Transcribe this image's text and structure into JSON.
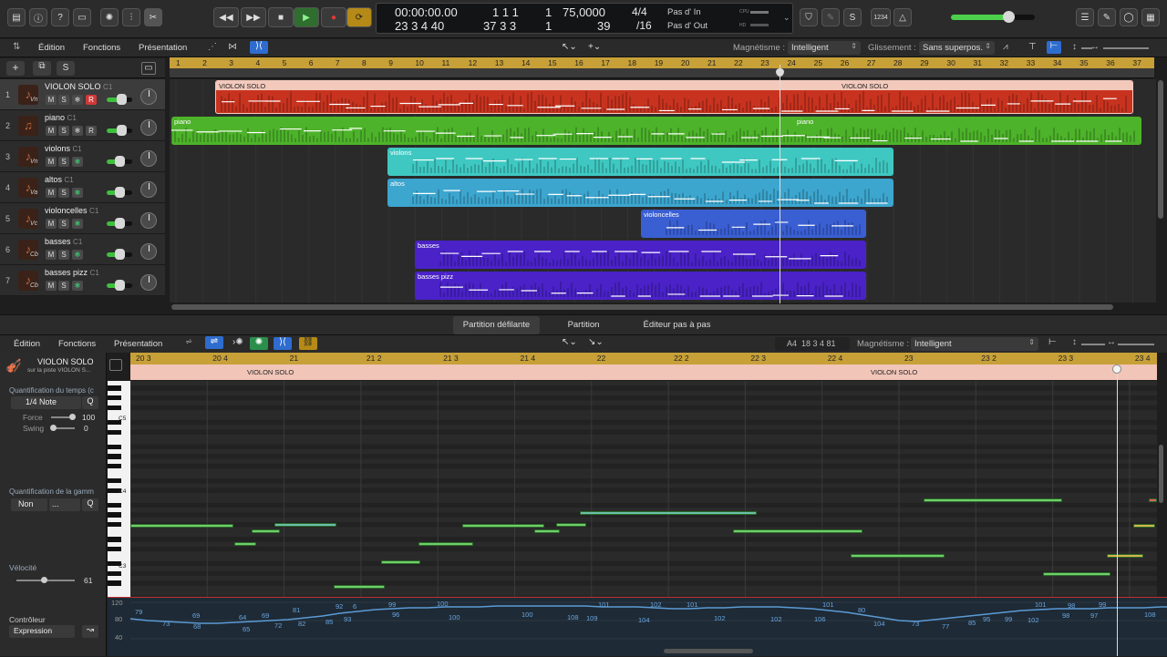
{
  "transport": {
    "time": "00:00:00.00",
    "time_small": "01",
    "smpte": "23 3 4 40",
    "bar": "1 1 1",
    "bar_beat": "1",
    "bar_pos": "37 3 3",
    "bar_pos_tick": "1",
    "tempo": "75,0000",
    "tempo_sub": "39",
    "signature": "4/4",
    "division": "/16",
    "in_label": "Pas d' In",
    "out_label": "Pas d' Out",
    "cpu_label": "CPU",
    "hd_label": "HD",
    "count_in": "1234"
  },
  "arrange_bar": {
    "menus": [
      "Édition",
      "Fonctions",
      "Présentation"
    ],
    "snap_label": "Magnétisme :",
    "snap_value": "Intelligent",
    "drag_label": "Glissement :",
    "drag_value": "Sans superpos."
  },
  "ruler_bars": [
    "1",
    "2",
    "3",
    "4",
    "5",
    "6",
    "7",
    "8",
    "9",
    "10",
    "11",
    "12",
    "13",
    "14",
    "15",
    "16",
    "17",
    "18",
    "19",
    "20",
    "21",
    "22",
    "23",
    "24",
    "25",
    "26",
    "27",
    "28",
    "29",
    "30",
    "31",
    "32",
    "33",
    "34",
    "35",
    "36",
    "37"
  ],
  "tracks": [
    {
      "num": "1",
      "name": "VIOLON SOLO",
      "ch": "C1",
      "inst": "Vn",
      "rec": true,
      "freeze": false
    },
    {
      "num": "2",
      "name": "piano",
      "ch": "C1",
      "inst": "",
      "rec": true,
      "freeze": false
    },
    {
      "num": "3",
      "name": "violons",
      "ch": "C1",
      "inst": "Vn",
      "rec": false,
      "freeze": true
    },
    {
      "num": "4",
      "name": "altos",
      "ch": "C1",
      "inst": "Va",
      "rec": false,
      "freeze": true
    },
    {
      "num": "5",
      "name": "violoncelles",
      "ch": "C1",
      "inst": "Vc",
      "rec": false,
      "freeze": true
    },
    {
      "num": "6",
      "name": "basses",
      "ch": "C1",
      "inst": "Cb",
      "rec": false,
      "freeze": true
    },
    {
      "num": "7",
      "name": "basses pizz",
      "ch": "C1",
      "inst": "Cb",
      "rec": false,
      "freeze": true
    }
  ],
  "region_labels": {
    "violon_solo_a": "VIOLON SOLO",
    "violon_solo_b": "VIOLON SOLO",
    "piano_a": "piano",
    "piano_b": "piano",
    "violons": "violons",
    "altos": "altos",
    "violoncelles": "violoncelles",
    "basses": "basses",
    "basses_pizz": "basses pizz"
  },
  "colors": {
    "red": "#c8331f",
    "green": "#4db32a",
    "teal": "#3fc8c2",
    "cyan": "#3ca6cf",
    "blue": "#3a5fd3",
    "purple": "#4a22c8"
  },
  "editor_tabs": [
    "Partition défilante",
    "Partition",
    "Éditeur pas à pas"
  ],
  "editor_bar": {
    "menus": [
      "Édition",
      "Fonctions",
      "Présentation"
    ],
    "position": "A4  18 3 4 81",
    "snap_label": "Magnétisme :",
    "snap_value": "Intelligent"
  },
  "inspector": {
    "region_name": "VIOLON SOLO",
    "region_sub": "sur la piste VIOLON S...",
    "quant_label": "Quantification du temps (c",
    "quant_value": "1/4 Note",
    "q": "Q",
    "force_label": "Force",
    "force_value": "100",
    "swing_label": "Swing",
    "swing_value": "0",
    "scale_label": "Quantification de la gamm",
    "scale_value": "Non",
    "scale_value2": "...",
    "velocity_label": "Vélocité",
    "velocity_value": "61",
    "controller_label": "Contrôleur",
    "controller_value": "Expression"
  },
  "editor_ruler": [
    "20 3",
    "20 4",
    "21",
    "21 2",
    "21 3",
    "21 4",
    "22",
    "22 2",
    "22 3",
    "22 4",
    "23",
    "23 2",
    "23 3",
    "23 4"
  ],
  "editor_region_label": "VIOLON SOLO",
  "key_labels": [
    "C5",
    "C4",
    "C3"
  ],
  "cc_axis": [
    "120",
    "80",
    "40"
  ],
  "cc_values_top": [
    "79",
    "69",
    "64",
    "69",
    "81",
    "92",
    "6",
    "99",
    "100",
    "101",
    "102",
    "101",
    "101",
    "80",
    "101",
    "98",
    "99"
  ],
  "cc_values_bottom": [
    "73",
    "68",
    "65",
    "72",
    "82",
    "85",
    "93",
    "96",
    "100",
    "100",
    "108",
    "109",
    "104",
    "102",
    "102",
    "106",
    "104",
    "73",
    "77",
    "85",
    "95",
    "99",
    "102",
    "98",
    "97",
    "108"
  ]
}
